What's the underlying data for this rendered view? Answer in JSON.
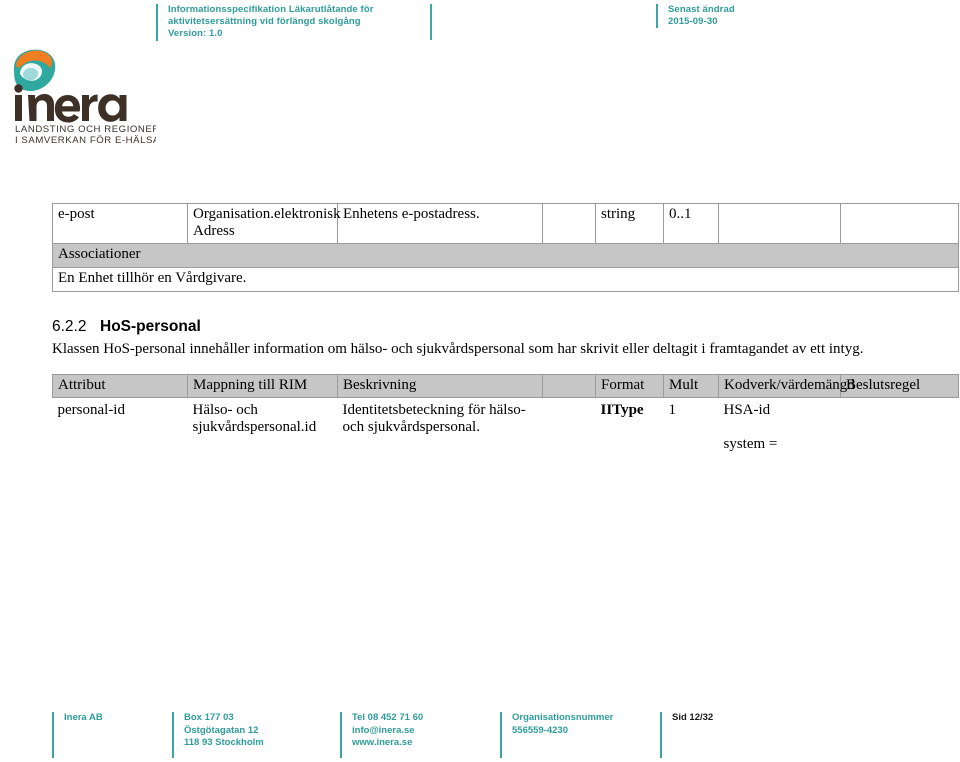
{
  "header": {
    "left_lines": [
      "Informationsspecifikation Läkarutlåtande för",
      "aktivitetsersättning vid förlängd skolgång",
      "Version: 1.0"
    ],
    "right_lines": [
      "Senast ändrad",
      "2015-09-30"
    ]
  },
  "logo": {
    "wordmark": "inera",
    "tagline_line1": "LANDSTING OCH REGIONER",
    "tagline_line2": "I SAMVERKAN FÖR E-HÄLSA",
    "colors": {
      "teal": "#2fa8a0",
      "orange": "#ef7e22",
      "wordmark_dark": "#3d3027"
    }
  },
  "table_enhet": {
    "rows": [
      {
        "type": "data",
        "cells": [
          "e-post",
          "Organisation.elektronisk Adress",
          "Enhetens e-postadress.",
          "",
          "string",
          "0..1",
          "",
          ""
        ]
      },
      {
        "type": "grey",
        "cells": [
          "Associationer"
        ]
      },
      {
        "type": "data",
        "cells": [
          "En Enhet tillhör en Vårdgivare."
        ]
      }
    ]
  },
  "section": {
    "number": "6.2.2",
    "title": "HoS-personal",
    "intro": "Klassen HoS-personal innehåller information om hälso- och sjukvårdspersonal som har skrivit eller deltagit i framtagandet av ett intyg."
  },
  "table_hos": {
    "headers": [
      "Attribut",
      "Mappning till RIM",
      "Beskrivning",
      "Format",
      "Mult",
      "Kodverk/värdemängd",
      "Beslutsregel"
    ],
    "rows": [
      {
        "attribut": "personal-id",
        "mappning": "Hälso- och sjukvårdspersonal.id",
        "beskrivning": "Identitetsbeteckning för hälso- och sjukvårdspersonal.",
        "format": "IIType",
        "mult": "1",
        "kodverk": "HSA-id",
        "kodverk2": "system =",
        "beslutsregel": ""
      }
    ]
  },
  "footer": {
    "company": [
      "Inera AB"
    ],
    "address": [
      "Box 177 03",
      "Östgötagatan 12",
      "118 93 Stockholm"
    ],
    "contact": [
      "Tel 08 452 71 60",
      "info@inera.se",
      "www.inera.se"
    ],
    "orgnr": [
      "Organisationsnummer",
      "556559-4230"
    ],
    "page": [
      "Sid 12/32"
    ]
  },
  "colors": {
    "accent_teal": "#2f9c9c",
    "rule_teal": "#3ba6a6",
    "table_border": "#9a9a9a",
    "table_header_bg": "#c6c6c6"
  }
}
